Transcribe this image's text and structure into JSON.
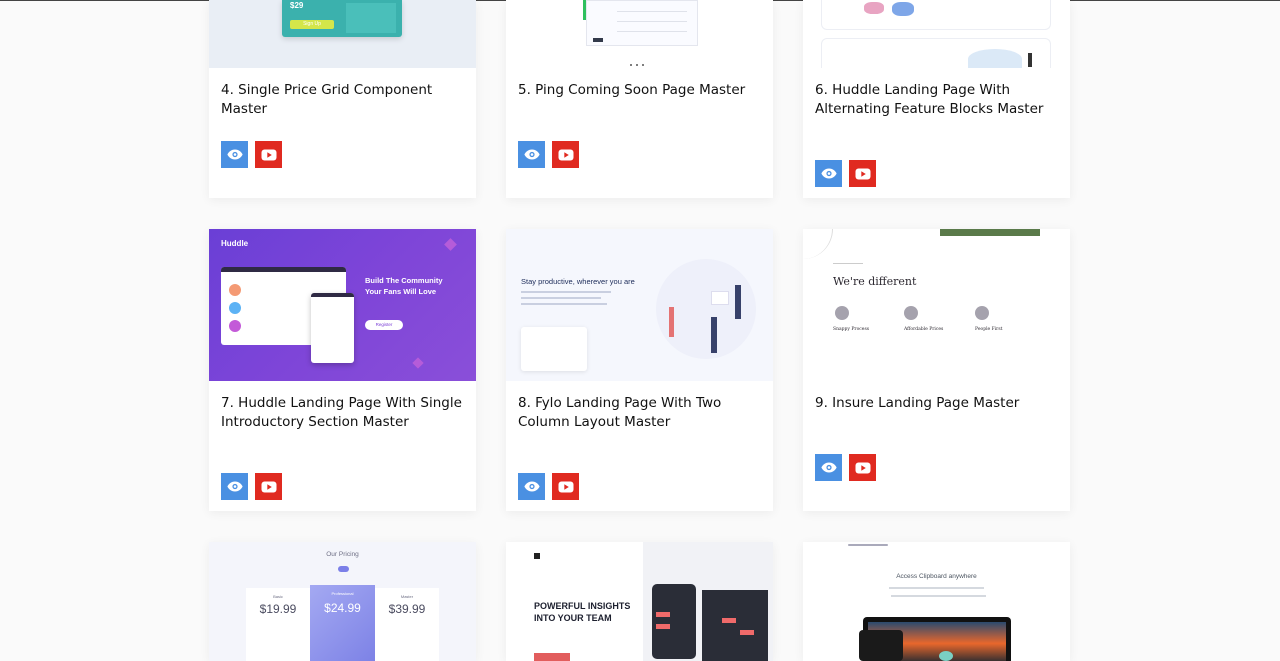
{
  "cards": [
    {
      "title": "4. Single Price Grid Component Master",
      "view_icon": "eye-icon",
      "video_icon": "youtube-icon",
      "thumb_text": {
        "price": "$29",
        "cta": "Sign Up"
      }
    },
    {
      "title": "5. Ping Coming Soon Page Master",
      "view_icon": "eye-icon",
      "video_icon": "youtube-icon"
    },
    {
      "title": "6. Huddle Landing Page With Alternating Feature Blocks Master",
      "view_icon": "eye-icon",
      "video_icon": "youtube-icon"
    },
    {
      "title": "7. Huddle Landing Page With Single Introductory Section Master",
      "view_icon": "eye-icon",
      "video_icon": "youtube-icon",
      "thumb_text": {
        "logo": "Huddle",
        "headline": "Build The Community Your Fans Will Love",
        "cta": "Register"
      }
    },
    {
      "title": "8. Fylo Landing Page With Two Column Layout Master",
      "view_icon": "eye-icon",
      "video_icon": "youtube-icon",
      "thumb_text": {
        "headline": "Stay productive, wherever you are"
      }
    },
    {
      "title": "9. Insure Landing Page Master",
      "view_icon": "eye-icon",
      "video_icon": "youtube-icon",
      "thumb_text": {
        "headline": "We're different",
        "f1": "Snappy Process",
        "f2": "Affordable Prices",
        "f3": "People First"
      }
    },
    {
      "title": "",
      "thumb_text": {
        "heading": "Our Pricing",
        "p1": "$19.99",
        "p2": "$24.99",
        "p3": "$39.99",
        "plan1": "Basic",
        "plan2": "Professional",
        "plan3": "Master"
      }
    },
    {
      "title": "",
      "thumb_text": {
        "headline": "POWERFUL INSIGHTS INTO YOUR TEAM"
      }
    },
    {
      "title": "",
      "thumb_text": {
        "headline": "Access Clipboard anywhere"
      }
    }
  ],
  "colors": {
    "view": "#4a90e2",
    "youtube": "#e02a20",
    "huddle": "#7a3ed6",
    "ping": "#4a5cd6"
  }
}
